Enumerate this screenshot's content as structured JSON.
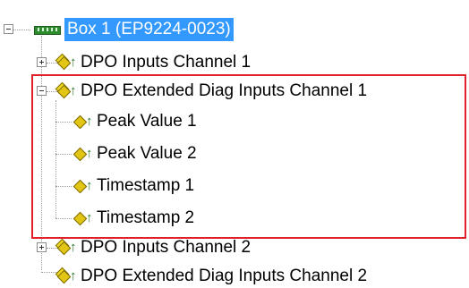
{
  "tree": {
    "root": {
      "label": "Box 1 (EP9224-0023)",
      "icon": "terminal-box-icon",
      "expanded": true,
      "selected": true
    },
    "items": [
      {
        "label": "DPO Inputs Channel 1",
        "icon": "process-data-inputs-icon",
        "expanded": false
      },
      {
        "label": "DPO Extended Diag Inputs Channel 1",
        "icon": "process-data-inputs-icon",
        "expanded": true,
        "children": [
          {
            "label": "Peak Value 1",
            "icon": "process-data-variable-icon"
          },
          {
            "label": "Peak Value 2",
            "icon": "process-data-variable-icon"
          },
          {
            "label": "Timestamp 1",
            "icon": "process-data-variable-icon"
          },
          {
            "label": "Timestamp 2",
            "icon": "process-data-variable-icon"
          }
        ]
      },
      {
        "label": "DPO Inputs Channel 2",
        "icon": "process-data-inputs-icon",
        "expanded": false
      },
      {
        "label": "DPO Extended Diag Inputs Channel 2",
        "icon": "process-data-inputs-icon",
        "expanded": false
      }
    ]
  },
  "highlight_color": "#e0202a",
  "selection_color": "#3399ff"
}
